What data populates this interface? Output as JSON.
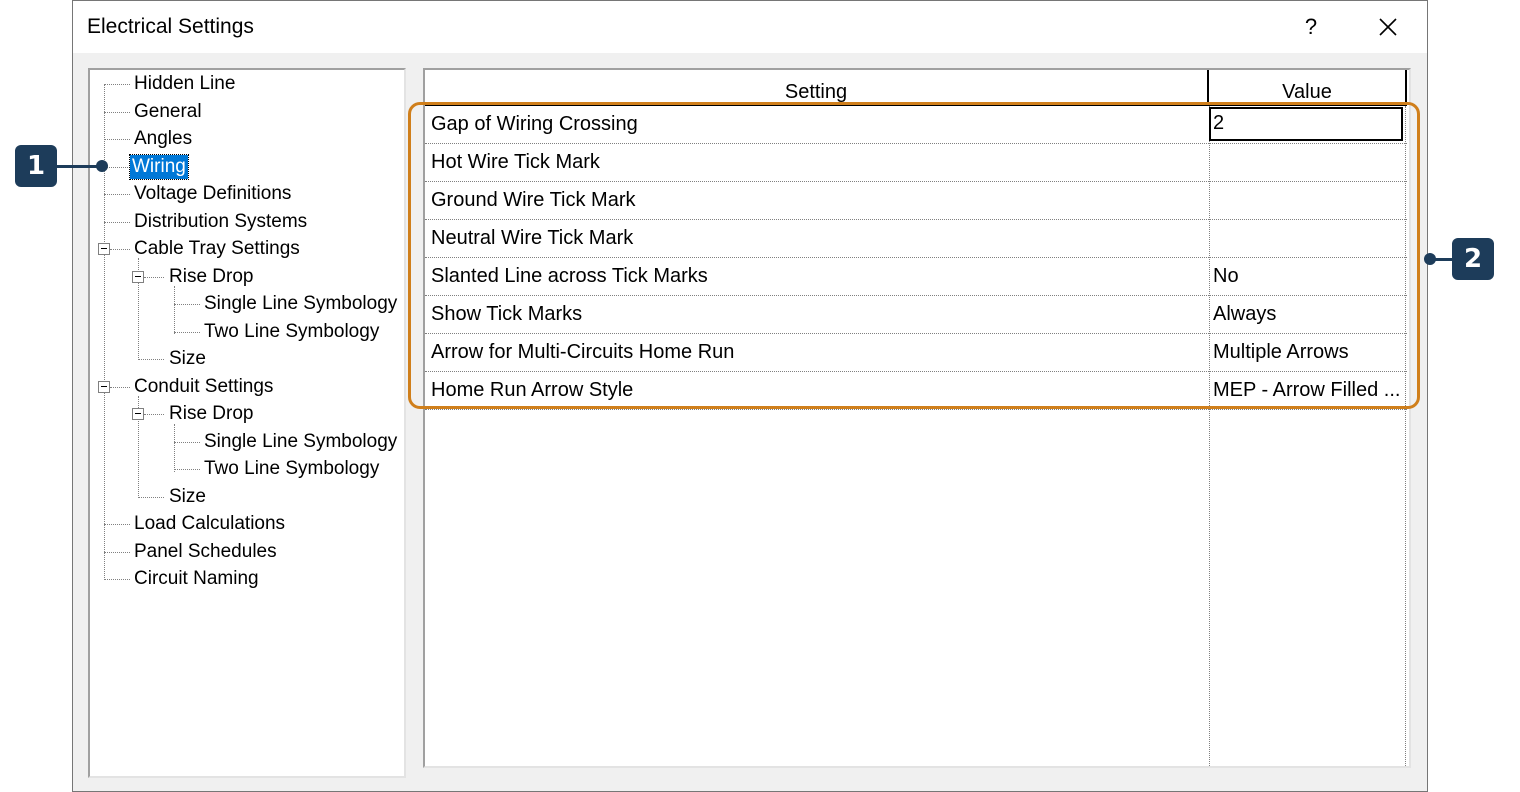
{
  "window": {
    "title": "Electrical Settings",
    "help_label": "?"
  },
  "tree": {
    "items": [
      {
        "label": "Hidden Line"
      },
      {
        "label": "General"
      },
      {
        "label": "Angles"
      },
      {
        "label": "Wiring",
        "selected": true
      },
      {
        "label": "Voltage Definitions"
      },
      {
        "label": "Distribution Systems"
      },
      {
        "label": "Cable Tray Settings",
        "expanded": true
      },
      {
        "label": "Rise Drop",
        "expanded": true
      },
      {
        "label": "Single Line Symbology"
      },
      {
        "label": "Two Line Symbology"
      },
      {
        "label": "Size"
      },
      {
        "label": "Conduit Settings",
        "expanded": true
      },
      {
        "label": "Rise Drop",
        "expanded": true
      },
      {
        "label": "Single Line Symbology"
      },
      {
        "label": "Two Line Symbology"
      },
      {
        "label": "Size"
      },
      {
        "label": "Load Calculations"
      },
      {
        "label": "Panel Schedules"
      },
      {
        "label": "Circuit Naming"
      }
    ]
  },
  "grid": {
    "columns": [
      "Setting",
      "Value"
    ],
    "rows": [
      {
        "setting": "Gap of Wiring Crossing",
        "value": "2"
      },
      {
        "setting": "Hot Wire Tick Mark",
        "value": ""
      },
      {
        "setting": "Ground Wire Tick Mark",
        "value": ""
      },
      {
        "setting": "Neutral Wire Tick Mark",
        "value": ""
      },
      {
        "setting": "Slanted Line across Tick Marks",
        "value": "No"
      },
      {
        "setting": "Show Tick Marks",
        "value": "Always"
      },
      {
        "setting": "Arrow for Multi-Circuits Home Run",
        "value": "Multiple Arrows"
      },
      {
        "setting": "Home Run Arrow Style",
        "value": "MEP - Arrow Filled ..."
      }
    ]
  },
  "callouts": {
    "one": "1",
    "two": "2",
    "color": "#d07f1b",
    "badge_color": "#1d3c5a"
  },
  "colors": {
    "selection": "#0078d7"
  }
}
